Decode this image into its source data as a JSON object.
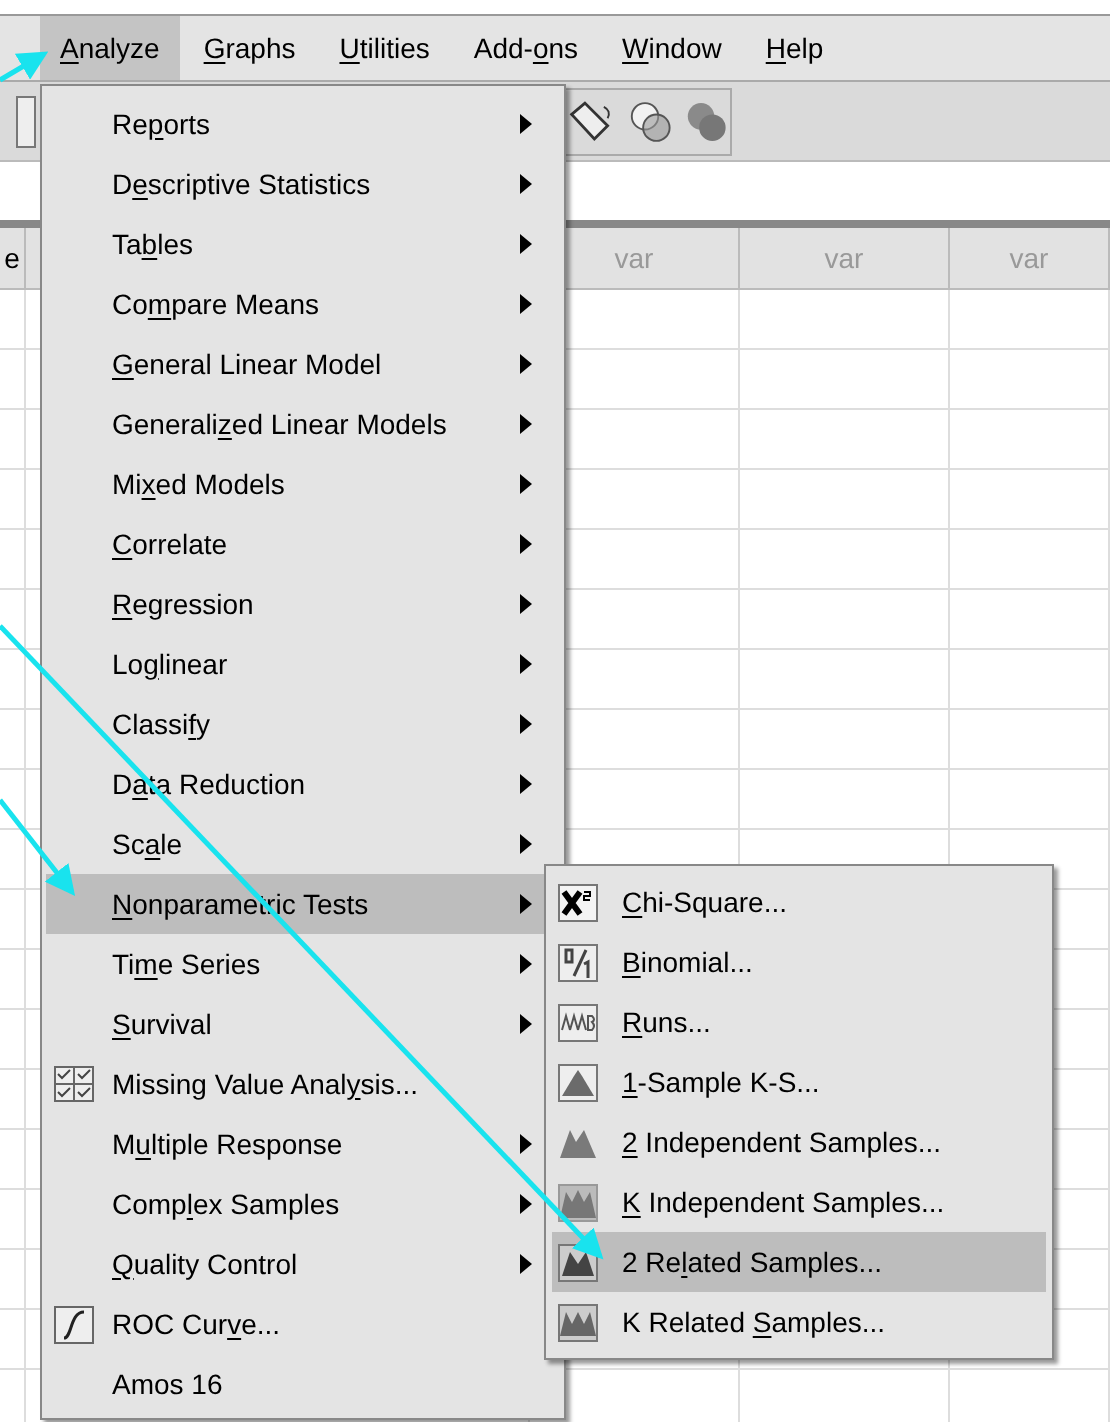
{
  "menu_bar": [
    {
      "label": {
        "key": "A",
        "after": "nalyze"
      },
      "selected": true
    },
    {
      "label": {
        "key": "G",
        "after": "raphs"
      },
      "selected": false
    },
    {
      "label": {
        "key": "U",
        "after": "tilities"
      },
      "selected": false
    },
    {
      "label": {
        "before": "Add-",
        "key": "o",
        "after": "ns"
      },
      "selected": false
    },
    {
      "label": {
        "key": "W",
        "after": "indow"
      },
      "selected": false
    },
    {
      "label": {
        "key": "H",
        "after": "elp"
      },
      "selected": false
    }
  ],
  "grid": {
    "columns": [
      "e",
      "",
      "var",
      "var",
      "var"
    ]
  },
  "analyze_menu": [
    {
      "kind": "submenu",
      "selected": false,
      "label": {
        "before": "Re",
        "key": "p",
        "after": "orts"
      }
    },
    {
      "kind": "submenu",
      "selected": false,
      "label": {
        "before": "D",
        "key": "e",
        "after": "scriptive Statistics"
      }
    },
    {
      "kind": "submenu",
      "selected": false,
      "label": {
        "before": "Ta",
        "key": "b",
        "after": "les"
      }
    },
    {
      "kind": "submenu",
      "selected": false,
      "label": {
        "before": "Co",
        "key": "m",
        "after": "pare Means"
      }
    },
    {
      "kind": "submenu",
      "selected": false,
      "label": {
        "key": "G",
        "after": "eneral Linear Model"
      }
    },
    {
      "kind": "submenu",
      "selected": false,
      "label": {
        "before": "Generali",
        "key": "z",
        "after": "ed Linear Models"
      }
    },
    {
      "kind": "submenu",
      "selected": false,
      "label": {
        "before": "Mi",
        "key": "x",
        "after": "ed Models"
      }
    },
    {
      "kind": "submenu",
      "selected": false,
      "label": {
        "key": "C",
        "after": "orrelate"
      }
    },
    {
      "kind": "submenu",
      "selected": false,
      "label": {
        "key": "R",
        "after": "egression"
      }
    },
    {
      "kind": "submenu",
      "selected": false,
      "label": {
        "before": "Lo",
        "key": "g",
        "after": "linear"
      }
    },
    {
      "kind": "submenu",
      "selected": false,
      "label": {
        "before": "Classi",
        "key": "f",
        "after": "y"
      }
    },
    {
      "kind": "submenu",
      "selected": false,
      "label": {
        "before": "D",
        "key": "a",
        "after": "ta Reduction"
      }
    },
    {
      "kind": "submenu",
      "selected": false,
      "label": {
        "before": "Sc",
        "key": "a",
        "after": "le"
      }
    },
    {
      "kind": "submenu",
      "selected": true,
      "label": {
        "key": "N",
        "after": "onparametric Tests"
      }
    },
    {
      "kind": "submenu",
      "selected": false,
      "label": {
        "before": "Ti",
        "key": "m",
        "after": "e Series"
      }
    },
    {
      "kind": "submenu",
      "selected": false,
      "label": {
        "key": "S",
        "after": "urvival"
      }
    },
    {
      "kind": "missing-values",
      "selected": false,
      "label": {
        "before": "Missing Value Anal",
        "key": "y",
        "after": "sis..."
      }
    },
    {
      "kind": "submenu",
      "selected": false,
      "label": {
        "before": "M",
        "key": "u",
        "after": "ltiple Response"
      }
    },
    {
      "kind": "submenu",
      "selected": false,
      "label": {
        "before": "Comp",
        "key": "l",
        "after": "ex Samples"
      }
    },
    {
      "kind": "submenu",
      "selected": false,
      "label": {
        "key": "Q",
        "after": "uality Control"
      }
    },
    {
      "kind": "roc",
      "selected": false,
      "label": {
        "before": "ROC Cur",
        "key": "v",
        "after": "e..."
      }
    },
    {
      "kind": "plain",
      "selected": false,
      "label": {
        "before": "Amos 16"
      }
    }
  ],
  "nonparametric_submenu": [
    {
      "kind": "chi-square",
      "selected": false,
      "label": {
        "key": "C",
        "after": "hi-Square..."
      }
    },
    {
      "kind": "binomial",
      "selected": false,
      "label": {
        "key": "B",
        "after": "inomial..."
      }
    },
    {
      "kind": "runs",
      "selected": false,
      "label": {
        "key": "R",
        "after": "uns..."
      }
    },
    {
      "kind": "one-peak",
      "selected": false,
      "label": {
        "key": "1",
        "after": "-Sample K-S..."
      }
    },
    {
      "kind": "two-peaks",
      "selected": false,
      "label": {
        "key": "2",
        "after": " Independent Samples..."
      }
    },
    {
      "kind": "many-peaks",
      "selected": false,
      "label": {
        "key": "K",
        "after": " Independent Samples..."
      }
    },
    {
      "kind": "two-peaks-boxed",
      "selected": true,
      "label": {
        "before": "2 Re",
        "key": "l",
        "after": "ated Samples..."
      }
    },
    {
      "kind": "many-peaks-boxed",
      "selected": false,
      "label": {
        "before": "K Related ",
        "key": "S",
        "after": "amples..."
      }
    }
  ]
}
